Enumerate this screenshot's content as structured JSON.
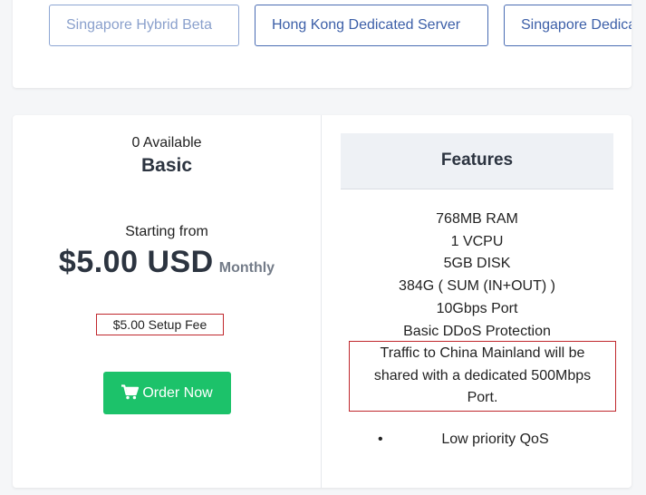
{
  "tabs": [
    {
      "label": "Singapore Hybrid Beta"
    },
    {
      "label": "Hong Kong Dedicated Server"
    },
    {
      "label": "Singapore Dedicated Server"
    }
  ],
  "plan": {
    "available": "0 Available",
    "name": "Basic",
    "starting_label": "Starting from",
    "price": "$5.00 USD",
    "cycle": "Monthly",
    "setup_fee": "$5.00 Setup Fee",
    "order_label": "Order Now",
    "order_icon": "cart-icon"
  },
  "features": {
    "heading": "Features",
    "items": [
      "768MB RAM",
      "1 VCPU",
      "5GB DISK",
      "384G ( SUM (IN+OUT) )",
      "10Gbps Port",
      "Basic DDoS Protection"
    ],
    "china_note_line1": "Traffic to China Mainland will be",
    "china_note_line2": "shared with a dedicated 500Mbps",
    "china_note_line3": "Port.",
    "bullet_item": "Low priority QoS"
  },
  "colors": {
    "tab_border": "#4a6cb3",
    "order_button": "#1cc26a",
    "annotation_red": "#c0272d"
  }
}
